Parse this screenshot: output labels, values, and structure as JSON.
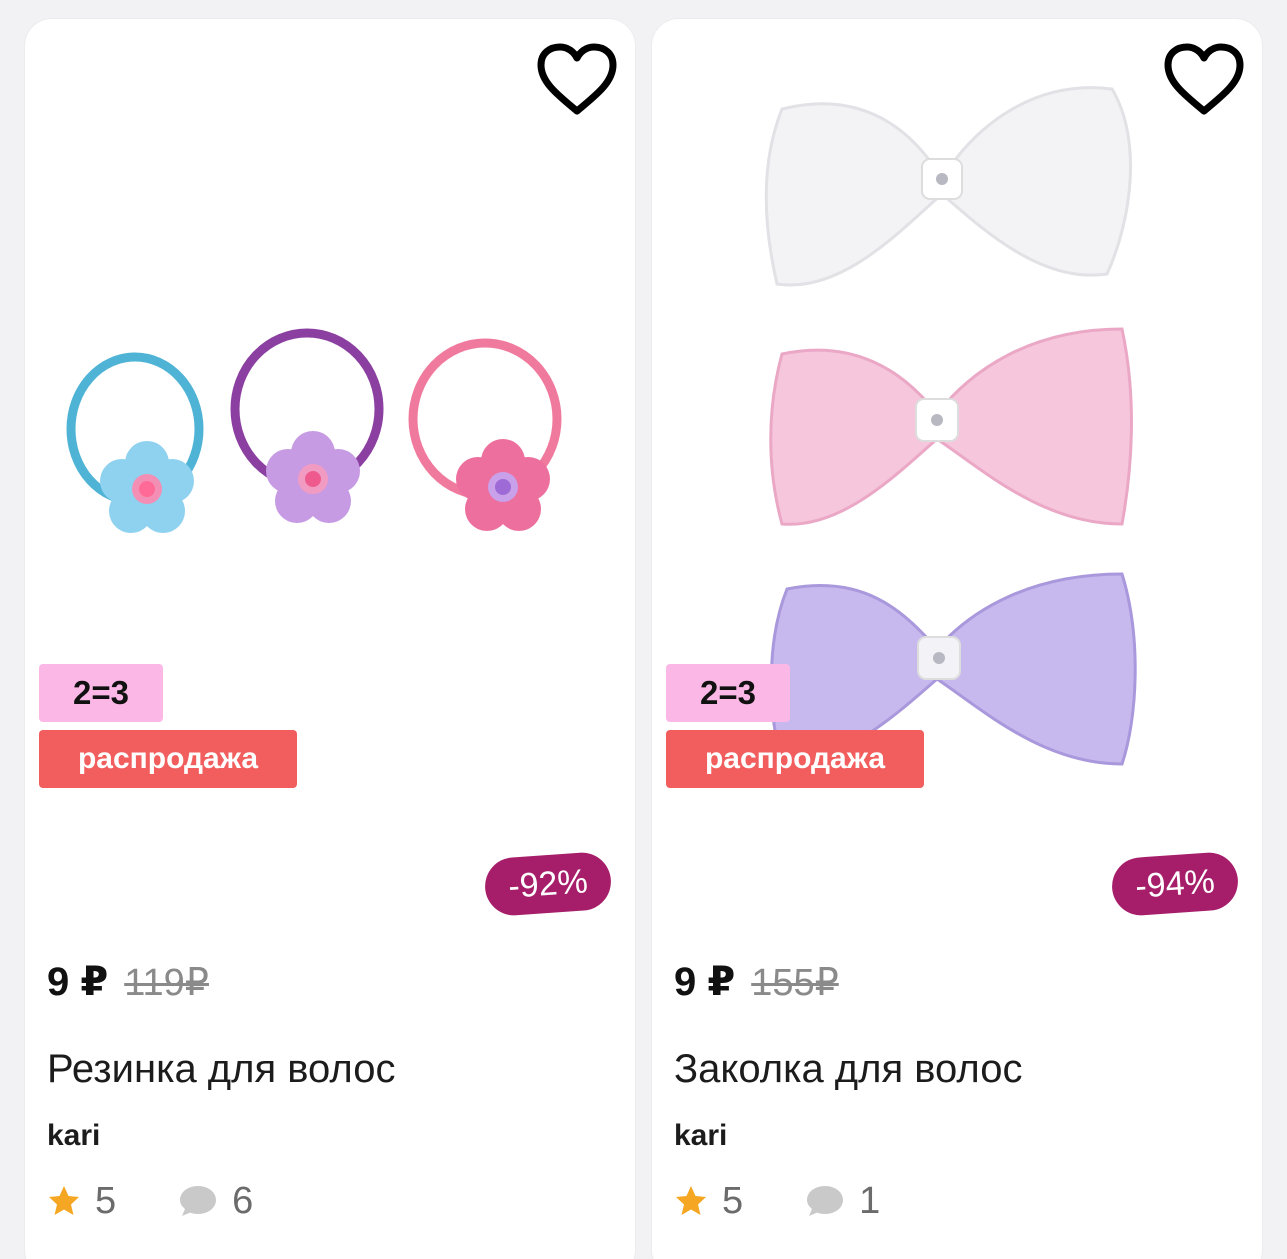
{
  "products": [
    {
      "promo": "2=3",
      "sale": "распродажа",
      "discount": "-92%",
      "price": "9 ₽",
      "old_price": "119₽",
      "title": "Резинка для волос",
      "brand": "kari",
      "rating": "5",
      "reviews": "6"
    },
    {
      "promo": "2=3",
      "sale": "распродажа",
      "discount": "-94%",
      "price": "9 ₽",
      "old_price": "155₽",
      "title": "Заколка для волос",
      "brand": "kari",
      "rating": "5",
      "reviews": "1"
    }
  ],
  "icons": {
    "favorite": "heart-outline-icon",
    "rating": "star-icon",
    "reviews": "speech-bubble-icon"
  },
  "colors": {
    "promo_bg": "#fbb8e6",
    "sale_bg": "#f25d5d",
    "discount_bg": "#a61e6a",
    "star": "#f5a623",
    "bubble": "#c9c9c9"
  }
}
